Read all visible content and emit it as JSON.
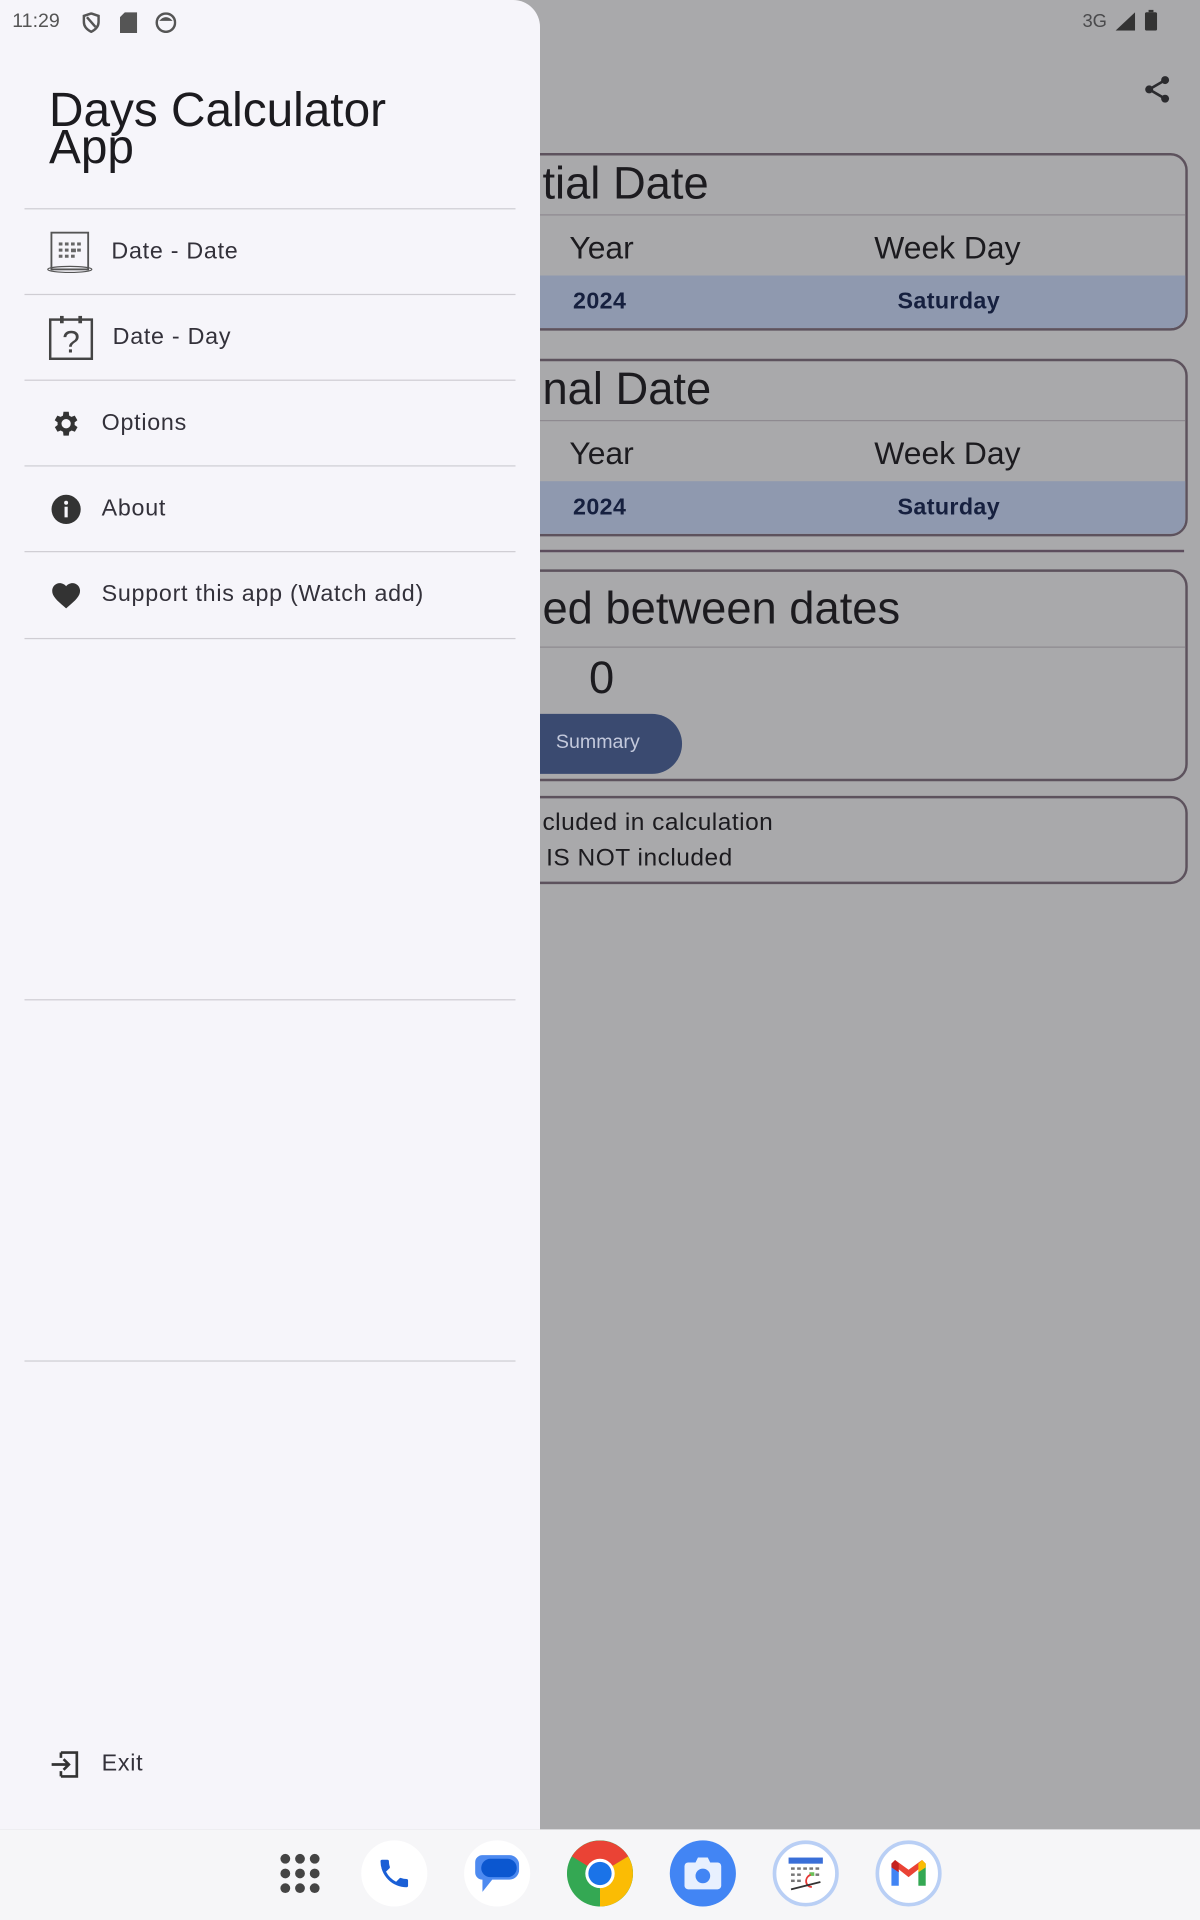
{
  "status_bar": {
    "time": "11:29",
    "network": "3G",
    "icons": [
      "shield-icon",
      "sd-card-icon",
      "face-icon",
      "signal-icon",
      "battery-icon"
    ]
  },
  "drawer": {
    "title": "Days Calculator App",
    "items": [
      {
        "label": "Date - Date",
        "icon": "calendar-grid-icon"
      },
      {
        "label": "Date - Day",
        "icon": "calendar-question-icon"
      },
      {
        "label": "Options",
        "icon": "gear-icon"
      },
      {
        "label": "About",
        "icon": "info-icon"
      },
      {
        "label": "Support this app (Watch add)",
        "icon": "heart-icon"
      }
    ],
    "exit_label": "Exit"
  },
  "main": {
    "initial": {
      "title": "tial Date",
      "year_label": "Year",
      "weekday_label": "Week Day",
      "year": "2024",
      "weekday": "Saturday"
    },
    "final": {
      "title": "nal Date",
      "year_label": "Year",
      "weekday_label": "Week Day",
      "year": "2024",
      "weekday": "Saturday"
    },
    "between": {
      "title": "ed between dates",
      "value": "0",
      "summary_label": "Summary"
    },
    "note": {
      "line1": "cluded in calculation",
      "line2": "IS NOT included"
    }
  },
  "colors": {
    "scrim": "#a9a9ab",
    "drawer": "#f6f5fa",
    "highlight": "#8f99af",
    "button": "#3a4a70"
  },
  "dock": [
    "app-drawer-icon",
    "phone-icon",
    "messages-icon",
    "chrome-icon",
    "camera-icon",
    "calendar-app-icon",
    "gmail-icon"
  ]
}
